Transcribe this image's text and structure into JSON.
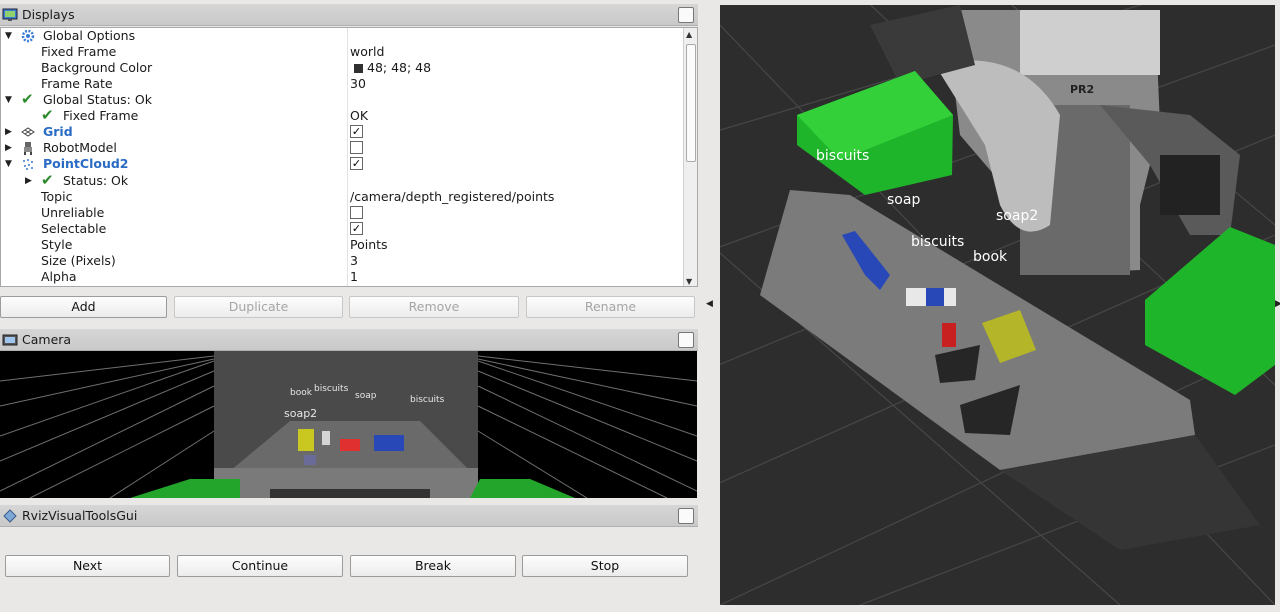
{
  "displays_panel": {
    "title": "Displays",
    "rows": [
      {
        "name": "Global Options",
        "value": ""
      },
      {
        "name": "Fixed Frame",
        "value": "world"
      },
      {
        "name": "Background Color",
        "value": "48; 48; 48"
      },
      {
        "name": "Frame Rate",
        "value": "30"
      },
      {
        "name": "Global Status: Ok",
        "value": ""
      },
      {
        "name": "Fixed Frame",
        "value": "OK"
      },
      {
        "name": "Grid",
        "value": ""
      },
      {
        "name": "RobotModel",
        "value": ""
      },
      {
        "name": "PointCloud2",
        "value": ""
      },
      {
        "name": "Status: Ok",
        "value": ""
      },
      {
        "name": "Topic",
        "value": "/camera/depth_registered/points"
      },
      {
        "name": "Unreliable",
        "value": ""
      },
      {
        "name": "Selectable",
        "value": ""
      },
      {
        "name": "Style",
        "value": "Points"
      },
      {
        "name": "Size (Pixels)",
        "value": "3"
      },
      {
        "name": "Alpha",
        "value": "1"
      }
    ],
    "checkboxes": {
      "grid": true,
      "robot_model": false,
      "pointcloud2": true,
      "unreliable": false,
      "selectable": true
    },
    "buttons": {
      "add": "Add",
      "duplicate": "Duplicate",
      "remove": "Remove",
      "rename": "Rename"
    }
  },
  "camera_panel": {
    "title": "Camera",
    "labels": {
      "book": "book",
      "biscuits_1": "biscuits",
      "soap": "soap",
      "biscuits_2": "biscuits",
      "soap2": "soap2"
    }
  },
  "rviz_tools_panel": {
    "title": "RvizVisualToolsGui",
    "buttons": {
      "next": "Next",
      "continue": "Continue",
      "break": "Break",
      "stop": "Stop"
    }
  },
  "main_view": {
    "labels": {
      "biscuits_1": "biscuits",
      "soap": "soap",
      "soap2": "soap2",
      "biscuits_2": "biscuits",
      "book": "book",
      "robot_logo": "PR2"
    }
  },
  "colors": {
    "background": "#303030",
    "grid": "#4a4a4a",
    "bin_green": "#1fb52a",
    "table_gray": "#7b7b7b",
    "link_blue": "#2a6bc4"
  }
}
